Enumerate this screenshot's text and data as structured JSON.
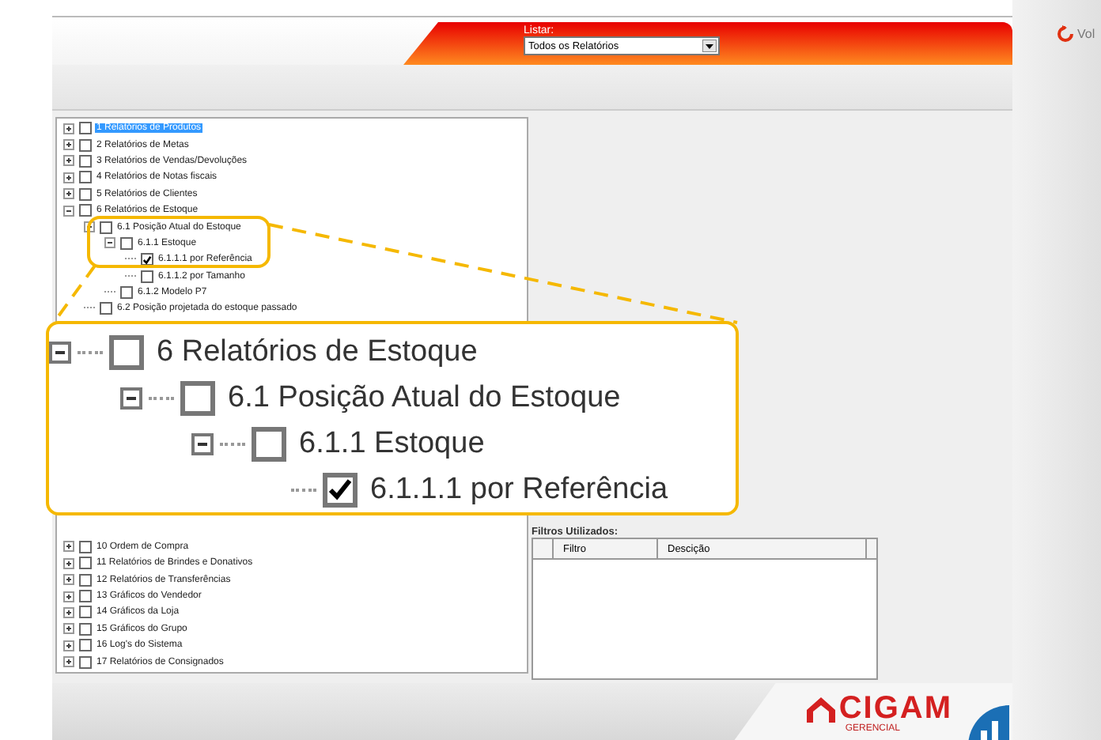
{
  "side_button": {
    "label": "Vol"
  },
  "header": {
    "list_label": "Listar:",
    "list_value": "Todos os Relatórios"
  },
  "tree_top": [
    {
      "label": "1 Relatórios de Produtos",
      "checked": false,
      "selected": true,
      "expanded": false
    },
    {
      "label": "2 Relatórios de Metas",
      "checked": false,
      "selected": false,
      "expanded": false
    },
    {
      "label": "3 Relatórios de Vendas/Devoluções",
      "checked": false,
      "selected": false,
      "expanded": false
    },
    {
      "label": "4 Relatórios de Notas fiscais",
      "checked": false,
      "selected": false,
      "expanded": false
    },
    {
      "label": "5 Relatórios de Clientes",
      "checked": false,
      "selected": false,
      "expanded": false
    },
    {
      "label": "6 Relatórios de Estoque",
      "checked": false,
      "selected": false,
      "expanded": true,
      "children": [
        {
          "label": "6.1 Posição Atual do Estoque",
          "checked": false,
          "selected": false,
          "expanded": true,
          "children": [
            {
              "label": "6.1.1 Estoque",
              "checked": false,
              "selected": false,
              "expanded": true,
              "children": [
                {
                  "label": "6.1.1.1 por Referência",
                  "checked": true,
                  "selected": false
                },
                {
                  "label": "6.1.1.2 por Tamanho",
                  "checked": false,
                  "selected": false
                }
              ]
            },
            {
              "label": "6.1.2 Modelo P7",
              "checked": false,
              "selected": false
            }
          ]
        },
        {
          "label": "6.2 Posição projetada do estoque passado",
          "checked": false,
          "selected": false
        }
      ]
    }
  ],
  "tree_bottom": [
    {
      "label": "10 Ordem de Compra",
      "checked": false,
      "selected": false,
      "expanded": false
    },
    {
      "label": "11 Relatórios de Brindes e Donativos",
      "checked": false,
      "selected": false,
      "expanded": false
    },
    {
      "label": "12 Relatórios de Transferências",
      "checked": false,
      "selected": false,
      "expanded": false
    },
    {
      "label": "13 Gráficos do Vendedor",
      "checked": false,
      "selected": false,
      "expanded": false
    },
    {
      "label": "14 Gráficos da Loja",
      "checked": false,
      "selected": false,
      "expanded": false
    },
    {
      "label": "15 Gráficos do Grupo",
      "checked": false,
      "selected": false,
      "expanded": false
    },
    {
      "label": "16 Log's do Sistema",
      "checked": false,
      "selected": false,
      "expanded": false
    },
    {
      "label": "17 Relatórios de Consignados",
      "checked": false,
      "selected": false,
      "expanded": false
    }
  ],
  "filters": {
    "title": "Filtros Utilizados:",
    "columns": [
      "Filtro",
      "Descição"
    ]
  },
  "logo": {
    "name": "CIGAM",
    "subtitle": "GERENCIAL"
  },
  "callout": [
    {
      "label": "6 Relatórios de Estoque",
      "checked": false,
      "expanded": true,
      "children": [
        {
          "label": "6.1 Posição Atual do Estoque",
          "checked": false,
          "expanded": true,
          "children": [
            {
              "label": "6.1.1 Estoque",
              "checked": false,
              "expanded": true,
              "children": [
                {
                  "label": "6.1.1.1 por Referência",
                  "checked": true
                }
              ]
            }
          ]
        }
      ]
    }
  ]
}
